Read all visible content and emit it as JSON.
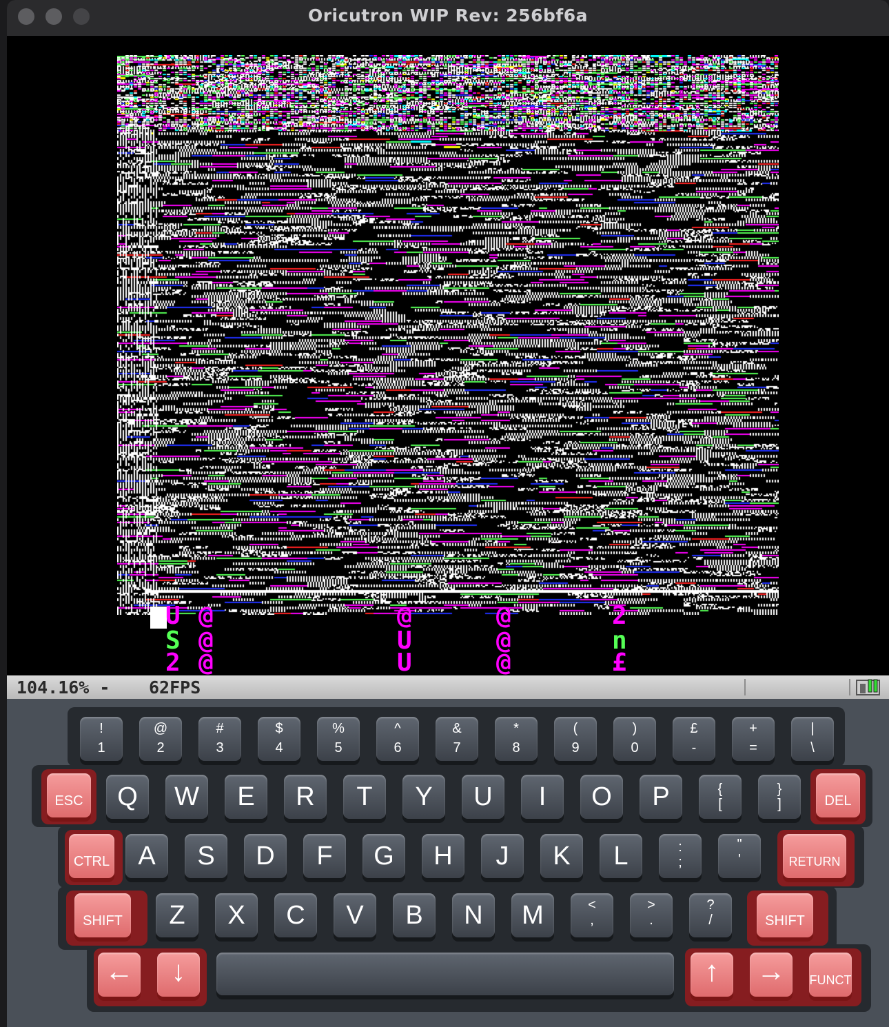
{
  "window": {
    "title": "Oricutron WIP Rev: 256bf6a"
  },
  "colors": {
    "magenta": "#ff00ff",
    "green": "#55ff55",
    "white": "#ffffff",
    "cyan": "#00ffff",
    "red": "#ff2020",
    "blue": "#2030ff",
    "yellow": "#ffff00",
    "key_red": "#e97b7d",
    "key_grey": "#4d535b"
  },
  "screen": {
    "chars": [
      {
        "text": "U",
        "color": "#ff00ff"
      },
      {
        "text": "@",
        "color": "#ff00ff"
      },
      {
        "text": "@",
        "color": "#ff00ff"
      },
      {
        "text": "@",
        "color": "#ff00ff"
      },
      {
        "text": "2",
        "color": "#ff00ff"
      },
      {
        "text": "S",
        "color": "#55ff55"
      },
      {
        "text": "@",
        "color": "#ff00ff"
      },
      {
        "text": "U",
        "color": "#ff00ff"
      },
      {
        "text": "@",
        "color": "#ff00ff"
      },
      {
        "text": "n",
        "color": "#55ff55"
      },
      {
        "text": "2",
        "color": "#ff00ff"
      },
      {
        "text": "@",
        "color": "#ff00ff"
      },
      {
        "text": "U",
        "color": "#ff00ff"
      },
      {
        "text": "@",
        "color": "#ff00ff"
      },
      {
        "text": "£",
        "color": "#ff00ff"
      }
    ]
  },
  "status": {
    "speed": "104.16% -",
    "fps": "62FPS"
  },
  "keyboard": {
    "row1": [
      {
        "top": "!",
        "bottom": "1"
      },
      {
        "top": "@",
        "bottom": "2"
      },
      {
        "top": "#",
        "bottom": "3"
      },
      {
        "top": "$",
        "bottom": "4"
      },
      {
        "top": "%",
        "bottom": "5"
      },
      {
        "top": "^",
        "bottom": "6"
      },
      {
        "top": "&",
        "bottom": "7"
      },
      {
        "top": "*",
        "bottom": "8"
      },
      {
        "top": "(",
        "bottom": "9"
      },
      {
        "top": ")",
        "bottom": "0"
      },
      {
        "top": "£",
        "bottom": "-"
      },
      {
        "top": "+",
        "bottom": "="
      },
      {
        "top": "|",
        "bottom": "\\"
      }
    ],
    "row2": {
      "left": "ESC",
      "keys": [
        "Q",
        "W",
        "E",
        "R",
        "T",
        "Y",
        "U",
        "I",
        "O",
        "P"
      ],
      "pairs": [
        {
          "top": "{",
          "bottom": "["
        },
        {
          "top": "}",
          "bottom": "]"
        }
      ],
      "right": "DEL"
    },
    "row3": {
      "left": "CTRL",
      "keys": [
        "A",
        "S",
        "D",
        "F",
        "G",
        "H",
        "J",
        "K",
        "L"
      ],
      "pairs": [
        {
          "top": ":",
          "bottom": ";"
        },
        {
          "top": "\"",
          "bottom": "'"
        }
      ],
      "right": "RETURN"
    },
    "row4": {
      "left": "SHIFT",
      "keys": [
        "Z",
        "X",
        "C",
        "V",
        "B",
        "N",
        "M"
      ],
      "pairs": [
        {
          "top": "<",
          "bottom": ","
        },
        {
          "top": ">",
          "bottom": "."
        },
        {
          "top": "?",
          "bottom": "/"
        }
      ],
      "right": "SHIFT"
    },
    "row5": {
      "left_arrow": "←",
      "down_arrow": "↓",
      "up_arrow": "↑",
      "right_arrow": "→",
      "funct": "FUNCT"
    }
  }
}
